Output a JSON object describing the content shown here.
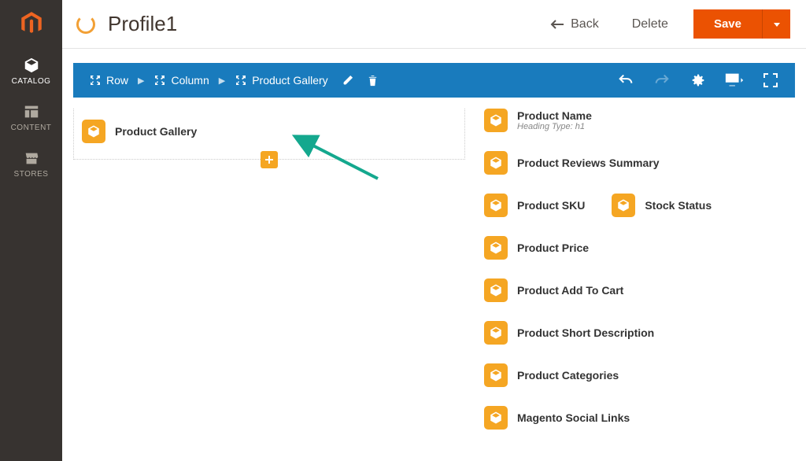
{
  "page": {
    "title": "Profile1"
  },
  "header": {
    "back": "Back",
    "delete": "Delete",
    "save": "Save"
  },
  "sidebar": {
    "items": [
      {
        "label": "CATALOG"
      },
      {
        "label": "CONTENT"
      },
      {
        "label": "STORES"
      }
    ]
  },
  "breadcrumb": {
    "row": "Row",
    "column": "Column",
    "gallery": "Product Gallery"
  },
  "left_widget": {
    "label": "Product Gallery"
  },
  "right_widgets": [
    {
      "label": "Product Name",
      "sub": "Heading Type: h1"
    },
    {
      "label": "Product Reviews Summary"
    },
    {
      "label": "Product SKU",
      "extra": "Stock Status"
    },
    {
      "label": "Product Price"
    },
    {
      "label": "Product Add To Cart"
    },
    {
      "label": "Product Short Description"
    },
    {
      "label": "Product Categories"
    },
    {
      "label": "Magento Social Links"
    }
  ]
}
